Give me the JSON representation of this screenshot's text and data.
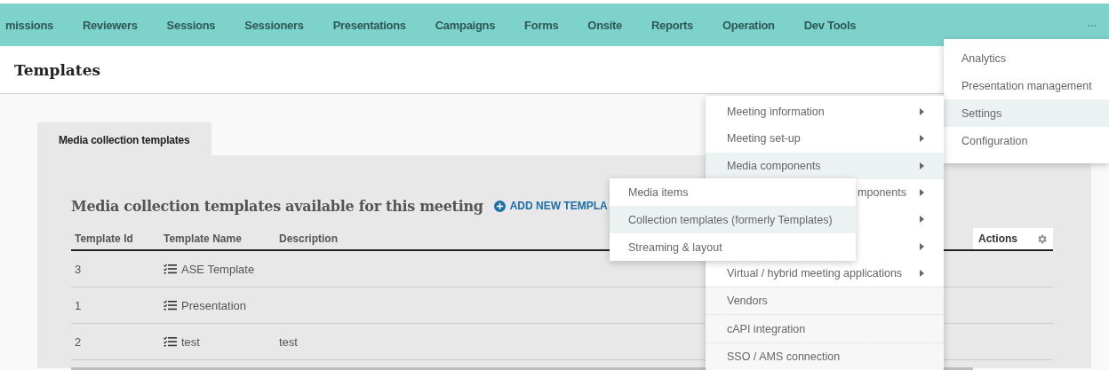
{
  "nav": {
    "items": [
      {
        "label": "missions"
      },
      {
        "label": "Reviewers"
      },
      {
        "label": "Sessions"
      },
      {
        "label": "Sessioners"
      },
      {
        "label": "Presentations"
      },
      {
        "label": "Campaigns"
      },
      {
        "label": "Forms"
      },
      {
        "label": "Onsite"
      },
      {
        "label": "Reports"
      },
      {
        "label": "Operation"
      },
      {
        "label": "Dev Tools"
      }
    ],
    "more": "..."
  },
  "page_title": "Templates",
  "tabs": [
    {
      "label": "Media collection templates",
      "selected": true
    }
  ],
  "section": {
    "title": "Media collection templates available for this meeting",
    "add_link": "ADD NEW TEMPLA"
  },
  "table": {
    "columns": [
      "Template Id",
      "Template Name",
      "Description"
    ],
    "actions_column": "Actions",
    "rows": [
      {
        "id": "3",
        "name": "ASE Template",
        "description": ""
      },
      {
        "id": "1",
        "name": "Presentation",
        "description": ""
      },
      {
        "id": "2",
        "name": "test",
        "description": "test"
      }
    ]
  },
  "more_menu": {
    "items": [
      {
        "label": "Analytics",
        "selected": false
      },
      {
        "label": "Presentation management",
        "selected": false
      },
      {
        "label": "Settings",
        "selected": true
      },
      {
        "label": "Configuration",
        "selected": false
      }
    ]
  },
  "settings_menu": {
    "items": [
      {
        "label": "Meeting information",
        "kind": "submenu",
        "selected": false
      },
      {
        "label": "Meeting set-up",
        "kind": "submenu",
        "selected": false
      },
      {
        "label": "Media components",
        "kind": "submenu",
        "selected": true
      },
      {
        "label": "mponents",
        "kind": "covered",
        "selected": false
      },
      {
        "kind": "hidden"
      },
      {
        "kind": "hidden"
      },
      {
        "label": "Virtual / hybrid meeting applications",
        "kind": "submenu",
        "selected": false
      },
      {
        "label": "Vendors",
        "kind": "link",
        "selected": false
      },
      {
        "label": "cAPI integration",
        "kind": "link",
        "selected": false
      },
      {
        "label": "SSO / AMS connection",
        "kind": "link",
        "selected": false
      }
    ]
  },
  "media_submenu": {
    "items": [
      {
        "label": "Media items",
        "selected": false
      },
      {
        "label": "Collection templates (formerly Templates)",
        "selected": true
      },
      {
        "label": "Streaming & layout",
        "selected": false
      }
    ]
  }
}
